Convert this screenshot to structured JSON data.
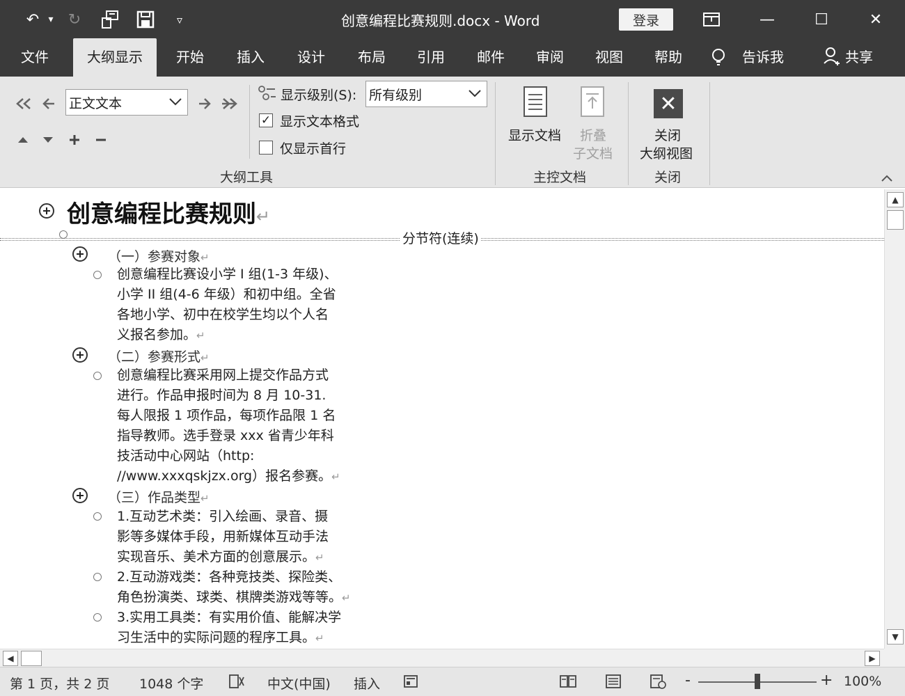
{
  "window": {
    "title": "创意编程比赛规则.docx  -  Word",
    "login_label": "登录",
    "controls": {
      "display_options": "⊡",
      "minimize": "—",
      "maximize": "☐",
      "close": "✕"
    }
  },
  "quick_access": {
    "undo": "↶",
    "undo_dropdown": "▾",
    "redo": "↻",
    "touch_mode": "☝",
    "save": "💾",
    "customize": "▿"
  },
  "menu": {
    "tabs": [
      "文件",
      "大纲显示",
      "开始",
      "插入",
      "设计",
      "布局",
      "引用",
      "邮件",
      "审阅",
      "视图",
      "帮助"
    ],
    "active_tab": "大纲显示",
    "tell_me": "告诉我",
    "share": "共享"
  },
  "ribbon": {
    "outline_tools": {
      "level_value": "正文文本",
      "show_level_label": "显示级别(S):",
      "show_level_value": "所有级别",
      "show_text_formatting": {
        "label": "显示文本格式",
        "checked": true
      },
      "show_first_line_only": {
        "label": "仅显示首行",
        "checked": false
      },
      "group_label": "大纲工具"
    },
    "master_document": {
      "show_document": "显示文档",
      "collapse_line1": "折叠",
      "collapse_line2": "子文档",
      "group_label": "主控文档"
    },
    "close": {
      "line1": "关闭",
      "line2": "大纲视图",
      "group_label": "关闭"
    }
  },
  "document": {
    "heading": "创意编程比赛规则",
    "section_break": "分节符(连续)",
    "para_mark": "↵",
    "sections": [
      {
        "title": "（一）参赛对象",
        "items": [
          {
            "lines": [
              "创意编程比赛设小学 I 组(1-3 年级)、",
              "小学 II 组(4-6 年级）和初中组。全省",
              "各地小学、初中在校学生均以个人名",
              "义报名参加。"
            ]
          }
        ]
      },
      {
        "title": "（二）参赛形式",
        "items": [
          {
            "lines": [
              "创意编程比赛采用网上提交作品方式",
              "进行。作品申报时间为 8 月 10-31.",
              "每人限报 1 项作品，每项作品限 1 名",
              "指导教师。选手登录 xxx 省青少年科",
              "技活动中心网站（http:",
              "//www.xxxqskjzx.org）报名参赛。"
            ]
          }
        ]
      },
      {
        "title": "（三）作品类型",
        "items": [
          {
            "lines": [
              "1.互动艺术类：引入绘画、录音、摄",
              "影等多媒体手段，用新媒体互动手法",
              "实现音乐、美术方面的创意展示。"
            ]
          },
          {
            "lines": [
              "2.互动游戏类：各种竞技类、探险类、",
              "角色扮演类、球类、棋牌类游戏等等。"
            ]
          },
          {
            "lines": [
              "3.实用工具类：有实用价值、能解决学",
              "习生活中的实际问题的程序工具。"
            ]
          }
        ]
      }
    ]
  },
  "status": {
    "page": "第 1 页，共 2 页",
    "words": "1048 个字",
    "language": "中文(中国)",
    "insert_mode": "插入",
    "zoom": "100%"
  }
}
